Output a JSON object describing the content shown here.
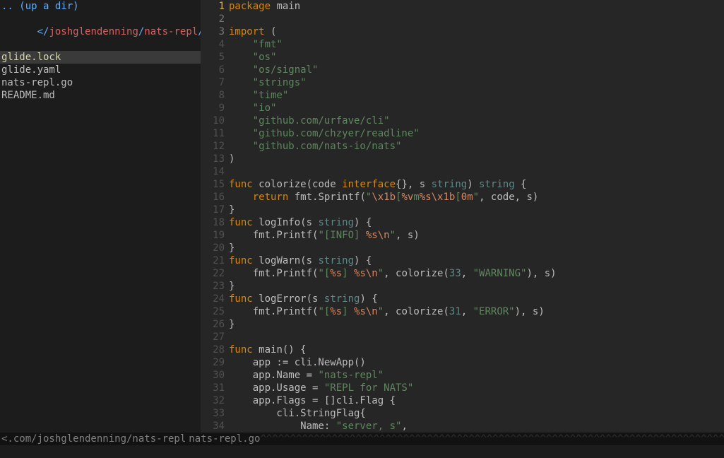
{
  "sidebar": {
    "up_dir": ".. (up a dir)",
    "path_prefix": "</",
    "path_segments": [
      "joshglendenning",
      "nats-repl"
    ],
    "path_suffix": "/",
    "files": [
      {
        "name": "glide.lock",
        "selected": true
      },
      {
        "name": "glide.yaml",
        "selected": false
      },
      {
        "name": "nats-repl.go",
        "selected": false
      },
      {
        "name": "README.md",
        "selected": false
      }
    ]
  },
  "gutter": {
    "start": 1,
    "end": 34,
    "current": 1
  },
  "code": {
    "lines": [
      [
        [
          "kw",
          "package"
        ],
        [
          "punc",
          " "
        ],
        [
          "ident",
          "main"
        ]
      ],
      [],
      [
        [
          "kw",
          "import"
        ],
        [
          "punc",
          " ("
        ]
      ],
      [
        [
          "punc",
          "    "
        ],
        [
          "str",
          "\"fmt\""
        ]
      ],
      [
        [
          "punc",
          "    "
        ],
        [
          "str",
          "\"os\""
        ]
      ],
      [
        [
          "punc",
          "    "
        ],
        [
          "str",
          "\"os/signal\""
        ]
      ],
      [
        [
          "punc",
          "    "
        ],
        [
          "str",
          "\"strings\""
        ]
      ],
      [
        [
          "punc",
          "    "
        ],
        [
          "str",
          "\"time\""
        ]
      ],
      [
        [
          "punc",
          "    "
        ],
        [
          "str",
          "\"io\""
        ]
      ],
      [
        [
          "punc",
          "    "
        ],
        [
          "str",
          "\"github.com/urfave/cli\""
        ]
      ],
      [
        [
          "punc",
          "    "
        ],
        [
          "str",
          "\"github.com/chzyer/readline\""
        ]
      ],
      [
        [
          "punc",
          "    "
        ],
        [
          "str",
          "\"github.com/nats-io/nats\""
        ]
      ],
      [
        [
          "punc",
          ")"
        ]
      ],
      [],
      [
        [
          "kw",
          "func"
        ],
        [
          "punc",
          " "
        ],
        [
          "ident",
          "colorize"
        ],
        [
          "punc",
          "(code "
        ],
        [
          "kw",
          "interface"
        ],
        [
          "punc",
          "{}, s "
        ],
        [
          "type",
          "string"
        ],
        [
          "punc",
          ") "
        ],
        [
          "type",
          "string"
        ],
        [
          "punc",
          " {"
        ]
      ],
      [
        [
          "punc",
          "    "
        ],
        [
          "kw",
          "return"
        ],
        [
          "punc",
          " fmt.Sprintf("
        ],
        [
          "str",
          "\""
        ],
        [
          "esc",
          "\\x1b"
        ],
        [
          "str",
          "["
        ],
        [
          "esc",
          "%v"
        ],
        [
          "str",
          "m"
        ],
        [
          "esc",
          "%s\\x1b"
        ],
        [
          "str",
          "["
        ],
        [
          "esc",
          "0m"
        ],
        [
          "str",
          "\""
        ],
        [
          "punc",
          ", code, s)"
        ]
      ],
      [
        [
          "punc",
          "}"
        ]
      ],
      [
        [
          "kw",
          "func"
        ],
        [
          "punc",
          " "
        ],
        [
          "ident",
          "logInfo"
        ],
        [
          "punc",
          "(s "
        ],
        [
          "type",
          "string"
        ],
        [
          "punc",
          ") {"
        ]
      ],
      [
        [
          "punc",
          "    fmt.Printf("
        ],
        [
          "str",
          "\"[INFO] "
        ],
        [
          "esc",
          "%s\\n"
        ],
        [
          "str",
          "\""
        ],
        [
          "punc",
          ", s)"
        ]
      ],
      [
        [
          "punc",
          "}"
        ]
      ],
      [
        [
          "kw",
          "func"
        ],
        [
          "punc",
          " "
        ],
        [
          "ident",
          "logWarn"
        ],
        [
          "punc",
          "(s "
        ],
        [
          "type",
          "string"
        ],
        [
          "punc",
          ") {"
        ]
      ],
      [
        [
          "punc",
          "    fmt.Printf("
        ],
        [
          "str",
          "\"["
        ],
        [
          "esc",
          "%s"
        ],
        [
          "str",
          "] "
        ],
        [
          "esc",
          "%s\\n"
        ],
        [
          "str",
          "\""
        ],
        [
          "punc",
          ", colorize("
        ],
        [
          "num",
          "33"
        ],
        [
          "punc",
          ", "
        ],
        [
          "str",
          "\"WARNING\""
        ],
        [
          "punc",
          "), s)"
        ]
      ],
      [
        [
          "punc",
          "}"
        ]
      ],
      [
        [
          "kw",
          "func"
        ],
        [
          "punc",
          " "
        ],
        [
          "ident",
          "logError"
        ],
        [
          "punc",
          "(s "
        ],
        [
          "type",
          "string"
        ],
        [
          "punc",
          ") {"
        ]
      ],
      [
        [
          "punc",
          "    fmt.Printf("
        ],
        [
          "str",
          "\"["
        ],
        [
          "esc",
          "%s"
        ],
        [
          "str",
          "] "
        ],
        [
          "esc",
          "%s\\n"
        ],
        [
          "str",
          "\""
        ],
        [
          "punc",
          ", colorize("
        ],
        [
          "num",
          "31"
        ],
        [
          "punc",
          ", "
        ],
        [
          "str",
          "\"ERROR\""
        ],
        [
          "punc",
          "), s)"
        ]
      ],
      [
        [
          "punc",
          "}"
        ]
      ],
      [],
      [
        [
          "kw",
          "func"
        ],
        [
          "punc",
          " "
        ],
        [
          "ident",
          "main"
        ],
        [
          "punc",
          "() {"
        ]
      ],
      [
        [
          "punc",
          "    app := cli.NewApp()"
        ]
      ],
      [
        [
          "punc",
          "    app.Name = "
        ],
        [
          "str",
          "\"nats-repl\""
        ]
      ],
      [
        [
          "punc",
          "    app.Usage = "
        ],
        [
          "str",
          "\"REPL for NATS\""
        ]
      ],
      [
        [
          "punc",
          "    app.Flags = []cli.Flag {"
        ]
      ],
      [
        [
          "punc",
          "        cli.StringFlag{"
        ]
      ],
      [
        [
          "punc",
          "            Name: "
        ],
        [
          "str",
          "\"server, s\""
        ],
        [
          "punc",
          ","
        ]
      ]
    ]
  },
  "status": {
    "left": "<.com/joshglendenning/nats-repl",
    "right": "nats-repl.go",
    "carets": "^^^^^^^^^^^^^^^^^^^^^^^^^^^^^^^^^^^^^^^^^^^^^^^^^^^^^^^^^^^^^^^^^^^^^^^^^^^^^^^^^^^^^^^^^^^^^^^^^^^^^^^^^^^^^^^^^^^^^^^^"
  }
}
